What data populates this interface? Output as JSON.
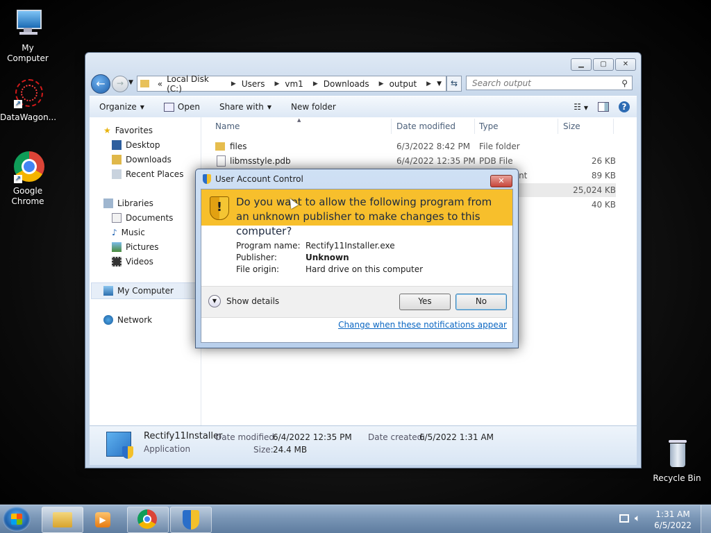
{
  "desktop": {
    "icons": [
      {
        "label": "My Computer"
      },
      {
        "label": "DataWagon..."
      },
      {
        "label": "Google Chrome"
      },
      {
        "label": "Recycle Bin"
      }
    ]
  },
  "explorer": {
    "address": {
      "prefix": "«",
      "crumbs": [
        "Local Disk (C:)",
        "Users",
        "vm1",
        "Downloads",
        "output"
      ]
    },
    "search_placeholder": "Search output",
    "toolbar": {
      "organize": "Organize",
      "open": "Open",
      "share_with": "Share with",
      "new_folder": "New folder"
    },
    "nav": {
      "favorites": "Favorites",
      "favorites_items": [
        "Desktop",
        "Downloads",
        "Recent Places"
      ],
      "libraries": "Libraries",
      "libraries_items": [
        "Documents",
        "Music",
        "Pictures",
        "Videos"
      ],
      "my_computer": "My Computer",
      "network": "Network"
    },
    "columns": {
      "name": "Name",
      "date": "Date modified",
      "type": "Type",
      "size": "Size"
    },
    "files": [
      {
        "name": "files",
        "date": "6/3/2022 8:42 PM",
        "type": "File folder",
        "size": ""
      },
      {
        "name": "libmsstyle.pdb",
        "date": "6/4/2022 12:35 PM",
        "type": "PDB File",
        "size": "26 KB"
      },
      {
        "name": "",
        "date": "",
        "type": "ment",
        "size": "89 KB"
      },
      {
        "name": "",
        "date": "",
        "type": "",
        "size": "25,024 KB"
      },
      {
        "name": "",
        "date": "",
        "type": "",
        "size": "40 KB"
      }
    ],
    "details": {
      "name": "Rectify11Installer",
      "kind": "Application",
      "modified_label": "Date modified:",
      "modified_value": "6/4/2022 12:35 PM",
      "created_label": "Date created:",
      "created_value": "6/5/2022 1:31 AM",
      "size_label": "Size:",
      "size_value": "24.4 MB"
    }
  },
  "uac": {
    "title": "User Account Control",
    "question": "Do you want to allow the following program from an unknown publisher to make changes to this computer?",
    "program_label": "Program name:",
    "program_value": "Rectify11Installer.exe",
    "publisher_label": "Publisher:",
    "publisher_value": "Unknown",
    "origin_label": "File origin:",
    "origin_value": "Hard drive on this computer",
    "show_details": "Show details",
    "yes": "Yes",
    "no": "No",
    "link": "Change when these notifications appear"
  },
  "taskbar": {
    "time": "1:31 AM",
    "date": "6/5/2022"
  }
}
